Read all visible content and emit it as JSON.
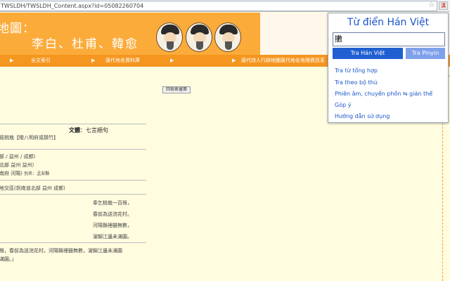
{
  "browser": {
    "url": "TWSLDH/TWSLDH_Content.aspx?id=05082260704",
    "star_icon": "star-icon",
    "extension_icon": "han-viet-extension-icon"
  },
  "banner": {
    "title_line1": "地圖：",
    "title_line2": "李白、杜甫、韓愈",
    "colors": {
      "banner": "#fbab3a",
      "nav": "#f59620"
    }
  },
  "nav": {
    "arrow": "▶",
    "items": [
      "全文索引",
      "唐代地名資料庫",
      "唐代詩人行跡地圖唐代地名地理資訊系"
    ]
  },
  "content": {
    "back_button": "回檢索畫面",
    "genre_label": "文體",
    "genre_value": "：七言絕句",
    "title_line": "覓桃栽【贈八明府覓緜竹】",
    "place_line1": "部 / 益州 / 成都)",
    "place_line2": "北部 益州 益州)",
    "place_line3": "南府 河陽)",
    "place_line3_small": "別名：孟安縣",
    "place_line4": "地交區(劍南道北部 益州 成都)",
    "poem": [
      "奉乞桃栽一百根，",
      "春前為送浣花村。",
      "河陽縣裡雖無數，",
      "濯錦江邊未滿園。"
    ],
    "full_text_line1": "根，春前為送浣花村。河陽縣裡雖無數，濯錦江邊未滿園",
    "full_text_line2": "滿園。」"
  },
  "dictionary": {
    "title": "Từ điển Hán Việt",
    "input_value": "擻",
    "button_han_viet": "Tra Hán Việt",
    "button_pinyin": "Tra Pinyin",
    "links": [
      "Tra từ tổng hợp",
      "Tra theo bộ thủ",
      "Phiên âm, chuyển phồn ⇆ giản thể",
      "Góp ý",
      "Hướng dẫn sử dụng"
    ],
    "colors": {
      "title": "#1a56c9",
      "button_primary": "#1f5fd1",
      "button_secondary": "#7fa0ea"
    }
  }
}
